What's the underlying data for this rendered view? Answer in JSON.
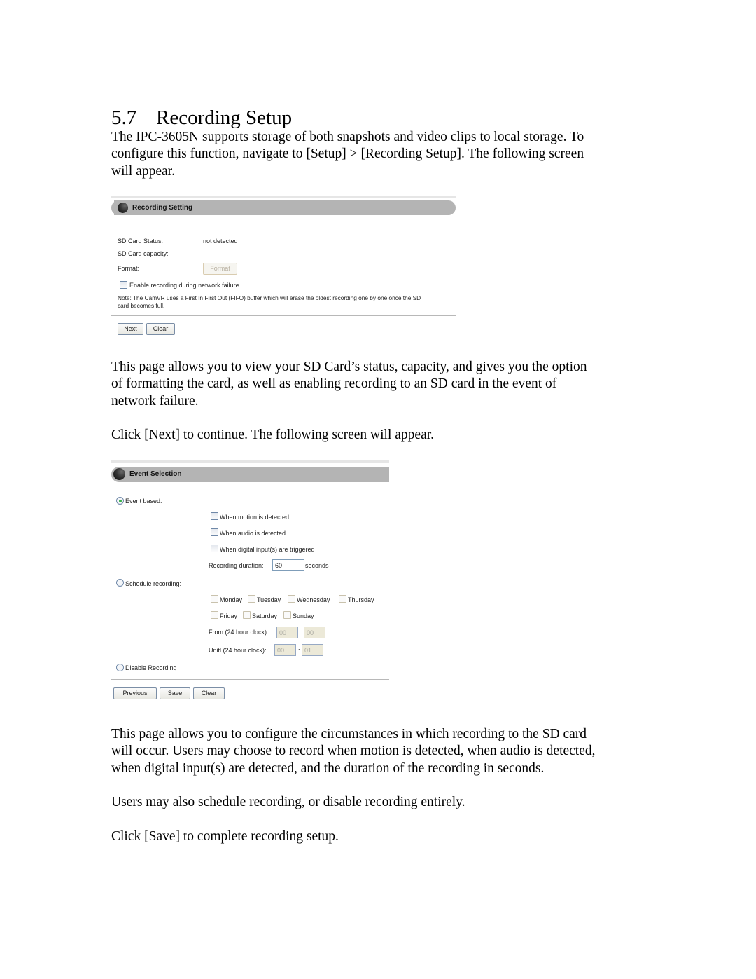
{
  "section": {
    "number": "5.7",
    "title": "Recording Setup"
  },
  "intro_lines": [
    "The IPC-3605N supports storage of both snapshots and video clips to local storage. To",
    "configure this function, navigate to [Setup] > [Recording Setup]. The following screen",
    "will appear."
  ],
  "recording_setting": {
    "header": "Recording Setting",
    "sd_status_label": "SD Card Status:",
    "sd_status_value": "not detected",
    "sd_capacity_label": "SD Card capacity:",
    "sd_capacity_value": "",
    "format_label": "Format:",
    "format_button": "Format",
    "enable_checkbox_label": "Enable recording during network failure",
    "enable_checked": false,
    "note_line1": "Note: The CamVR uses a First In First Out (FIFO) buffer which will erase the oldest recording one by one once the SD",
    "note_line2": "card becomes full.",
    "next_button": "Next",
    "clear_button": "Clear"
  },
  "para2_lines": [
    "This page allows you to view your SD Card’s status, capacity, and gives you the option",
    "of formatting the card, as well as enabling recording to an SD card in the event of",
    "network failure."
  ],
  "para3": "Click [Next] to continue. The following screen will appear.",
  "event_selection": {
    "header": "Event Selection",
    "event_based_label": "Event based:",
    "event_based_selected": true,
    "triggers": [
      {
        "label": "When motion is detected",
        "checked": false
      },
      {
        "label": "When audio is detected",
        "checked": false
      },
      {
        "label": "When digital input(s) are triggered",
        "checked": false
      }
    ],
    "duration_label": "Recording duration:",
    "duration_value": "60",
    "duration_unit": "seconds",
    "schedule_label": "Schedule recording:",
    "schedule_selected": false,
    "days_row1": [
      "Monday",
      "Tuesday",
      "Wednesday",
      "Thursday"
    ],
    "days_row2": [
      "Friday",
      "Saturday",
      "Sunday"
    ],
    "from_label": "From (24 hour clock):",
    "from_hour": "00",
    "from_minute": "00",
    "until_label": "Unitl (24 hour clock):",
    "until_hour": "00",
    "until_minute": "01",
    "time_separator": ":",
    "disable_label": "Disable Recording",
    "disable_selected": false,
    "previous_button": "Previous",
    "save_button": "Save",
    "clear_button": "Clear"
  },
  "para4_lines": [
    "This page allows you to configure the circumstances in which recording to the SD card",
    "will occur. Users may choose to record when motion is detected, when audio is detected,",
    "when digital input(s) are detected, and the duration of the recording in seconds."
  ],
  "para5": "Users may also schedule recording, or disable recording entirely.",
  "para6": "Click [Save] to complete recording setup."
}
